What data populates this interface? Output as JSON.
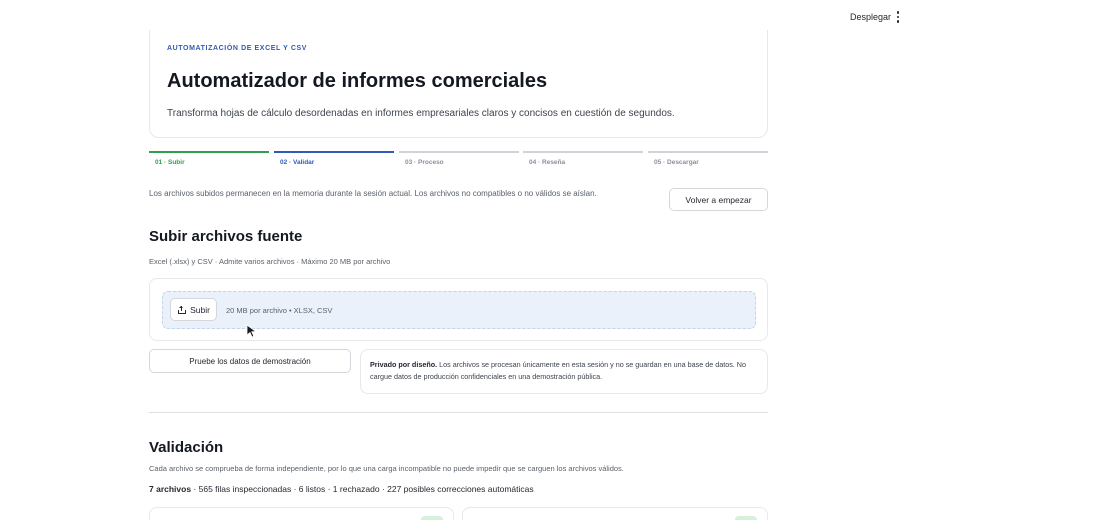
{
  "topbar": {
    "deploy_label": "Desplegar",
    "menu_icon": "kebab-menu-icon"
  },
  "hero": {
    "eyebrow": "AUTOMATIZACIÓN DE EXCEL Y CSV",
    "title": "Automatizador de informes comerciales",
    "description": "Transforma hojas de cálculo desordenadas en informes empresariales claros y concisos en cuestión de segundos."
  },
  "steps": [
    {
      "label": "01 · Subir",
      "state": "done"
    },
    {
      "label": "02 · Validar",
      "state": "active"
    },
    {
      "label": "03 · Proceso",
      "state": "pending"
    },
    {
      "label": "04 · Reseña",
      "state": "pending"
    },
    {
      "label": "05 · Descargar",
      "state": "pending"
    }
  ],
  "session": {
    "note": "Los archivos subidos permanecen en la memoria durante la sesión actual. Los archivos no compatibles o no válidos se aíslan.",
    "restart_label": "Volver a empezar"
  },
  "upload": {
    "title": "Subir archivos fuente",
    "subtitle": "Excel (.xlsx) y CSV · Admite varios archivos · Máximo 20 MB por archivo",
    "button_label": "Subir",
    "hint": "20 MB por archivo • XLSX, CSV",
    "demo_label": "Pruebe los datos de demostración",
    "privacy_bold": "Privado por diseño.",
    "privacy_text": " Los archivos se procesan únicamente en esta sesión y no se guardan en una base de datos. No cargue datos de producción confidenciales en una demostración pública."
  },
  "validation": {
    "title": "Validación",
    "subtitle": "Cada archivo se comprueba de forma independiente, por lo que una carga incompatible no puede impedir que se carguen los archivos válidos.",
    "summary_bold": "7 archivos",
    "summary_rest": " · 565 filas inspeccionadas · 6 listos · 1 rechazado · 227 posibles correcciones automáticas"
  },
  "colors": {
    "accent_blue": "#2f5bb7",
    "success_green": "#2e9e4f",
    "dropzone_bg": "#eaf1fb"
  }
}
